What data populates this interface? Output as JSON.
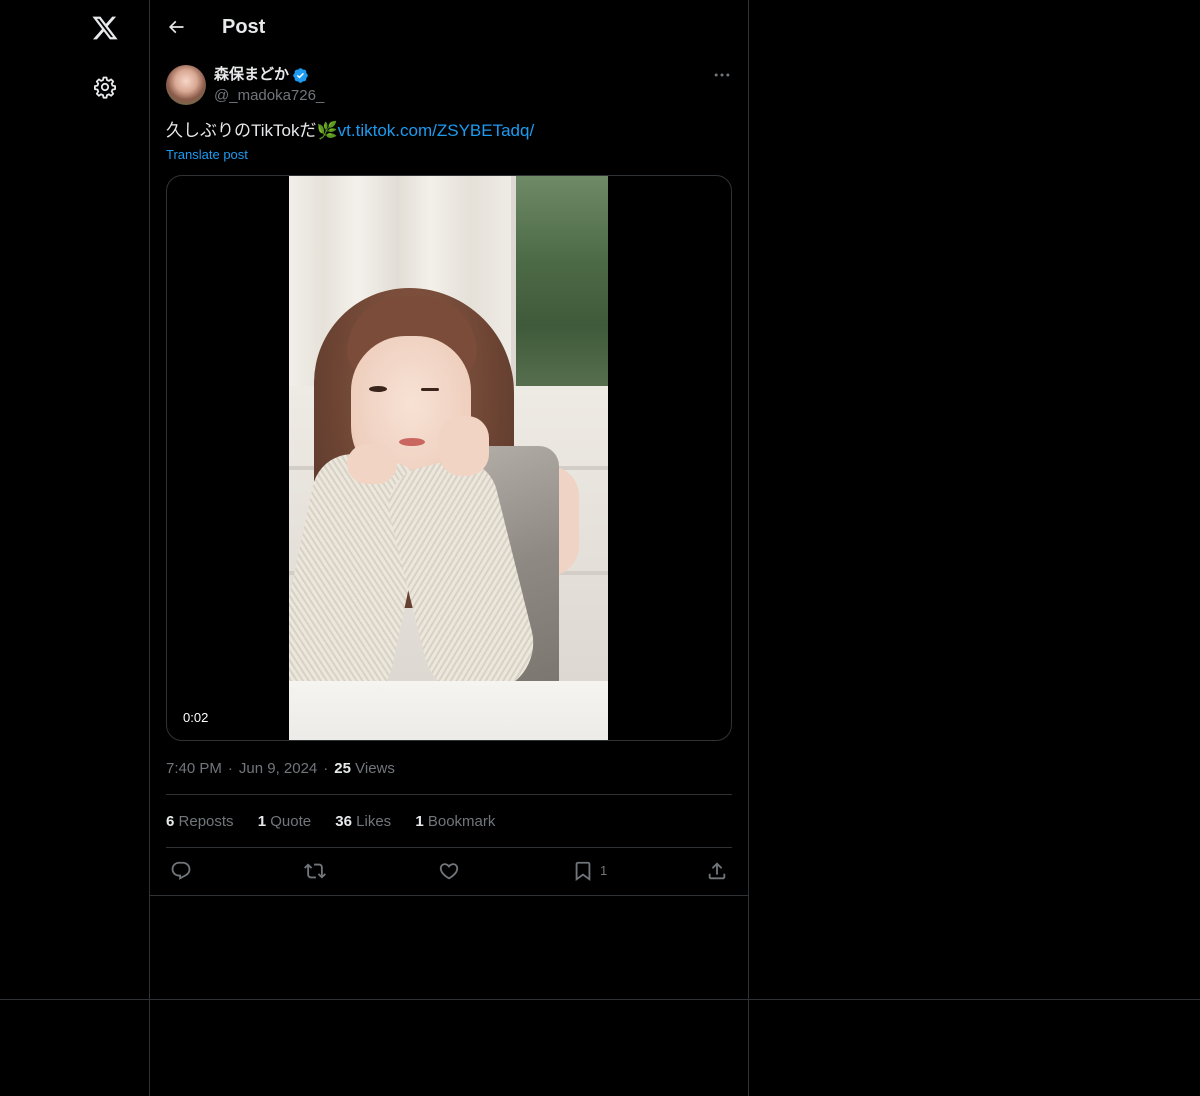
{
  "app": {
    "name": "X"
  },
  "nav": {
    "logo_icon": "x-logo-icon",
    "settings_icon": "gear-icon"
  },
  "header": {
    "title": "Post",
    "back_icon": "arrow-left-icon"
  },
  "post": {
    "author": {
      "display_name": "森保まどか",
      "handle": "@_madoka726_",
      "verified": true,
      "verified_color": "#1d9bf0"
    },
    "text_prefix": "久しぶりのTikTokだ",
    "emoji": "🌿",
    "link_text": "vt.tiktok.com/ZSYBETadq/",
    "translate_label": "Translate post",
    "media": {
      "type": "video",
      "duration": "0:02"
    },
    "time": "7:40 PM",
    "date": "Jun 9, 2024",
    "views_count": "25",
    "views_label": "Views",
    "stats": {
      "reposts_count": "6",
      "reposts_label": "Reposts",
      "quotes_count": "1",
      "quotes_label": "Quote",
      "likes_count": "36",
      "likes_label": "Likes",
      "bookmarks_count": "1",
      "bookmarks_label": "Bookmark"
    },
    "actions": {
      "reply_icon": "reply-icon",
      "repost_icon": "repost-icon",
      "like_icon": "heart-icon",
      "bookmark_icon": "bookmark-icon",
      "bookmark_count": "1",
      "share_icon": "share-icon"
    }
  },
  "colors": {
    "background": "#000000",
    "text_primary": "#e7e9ea",
    "text_secondary": "#71767b",
    "accent": "#1d9bf0",
    "border": "#2f3336"
  }
}
